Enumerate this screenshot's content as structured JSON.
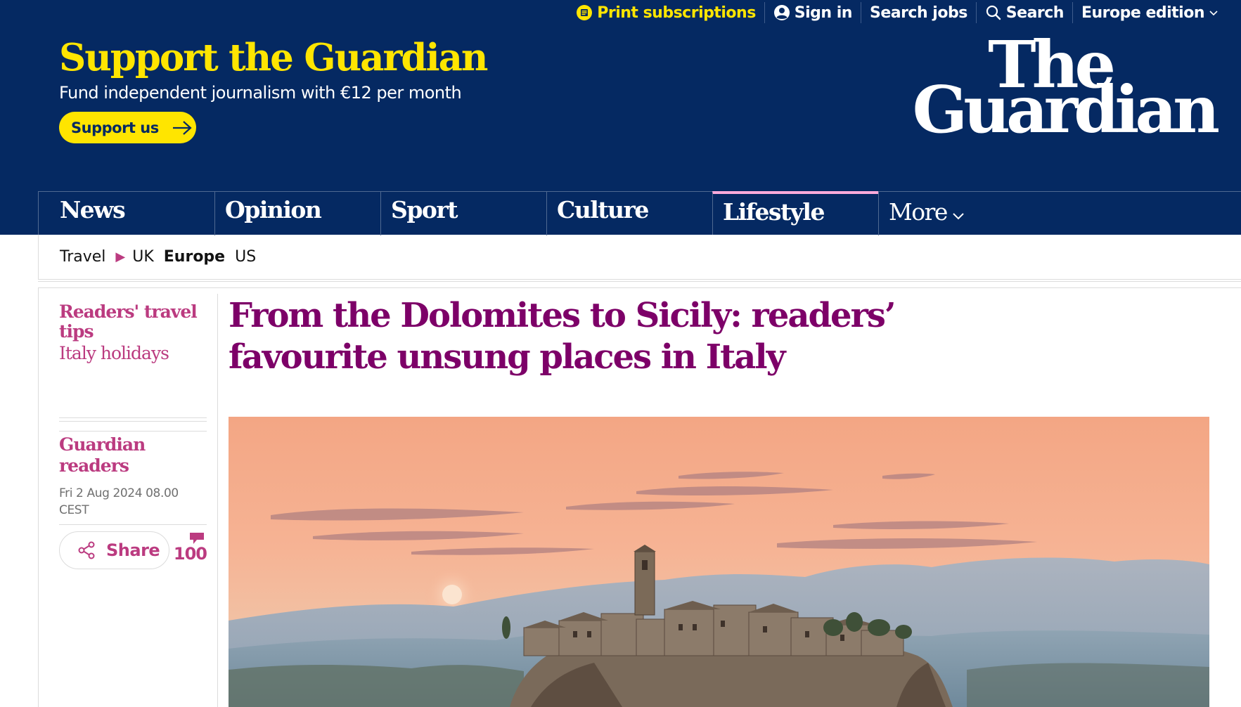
{
  "topbar": {
    "print_subscriptions": "Print subscriptions",
    "sign_in": "Sign in",
    "search_jobs": "Search jobs",
    "search": "Search",
    "edition": "Europe edition"
  },
  "masthead": {
    "support_title": "Support the Guardian",
    "support_sub": "Fund independent journalism with €12 per month",
    "support_button": "Support us",
    "logo_line1": "The",
    "logo_line2": "Guardian"
  },
  "nav": {
    "items": [
      {
        "label": "News"
      },
      {
        "label": "Opinion"
      },
      {
        "label": "Sport"
      },
      {
        "label": "Culture"
      },
      {
        "label": "Lifestyle"
      },
      {
        "label": "More"
      }
    ],
    "active": "Lifestyle",
    "active_color": "#ffabdb"
  },
  "subnav": {
    "section": "Travel",
    "items": [
      "UK",
      "Europe",
      "US"
    ],
    "active": "Europe"
  },
  "article": {
    "series": "Readers' travel tips",
    "tag": "Italy holidays",
    "headline": "From the Dolomites to Sicily: readers’ favourite unsung places in Italy",
    "byline": "Guardian readers",
    "date": "Fri 2 Aug 2024 08.00 CEST",
    "share_label": "Share",
    "comment_count": "100"
  },
  "colors": {
    "brand_blue": "#052962",
    "support_yellow": "#ffe500",
    "lifestyle_accent": "#bb3b80",
    "headline_color": "#7d0068"
  }
}
